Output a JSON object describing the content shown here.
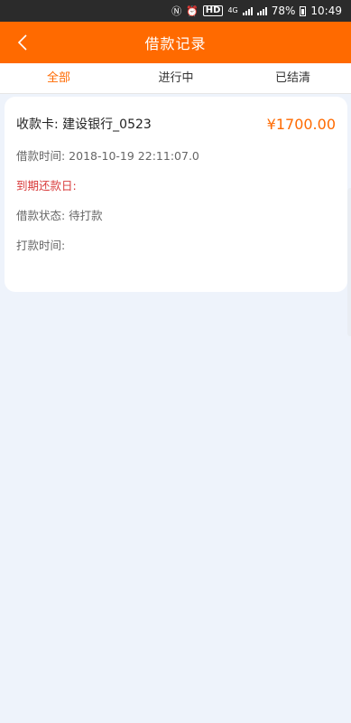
{
  "status_bar": {
    "hd_label": "HD",
    "network_label": "4G",
    "battery_percent": "78%",
    "time": "10:49"
  },
  "header": {
    "title": "借款记录"
  },
  "tabs": [
    {
      "label": "全部",
      "active": true
    },
    {
      "label": "进行中",
      "active": false
    },
    {
      "label": "已结清",
      "active": false
    }
  ],
  "record": {
    "account": "收款卡: 建设银行_0523",
    "amount": "¥1700.00",
    "loan_time": "借款时间: 2018-10-19 22:11:07.0",
    "due_date": "到期还款日:",
    "status": "借款状态: 待打款",
    "payout_time": "打款时间:"
  },
  "colors": {
    "accent": "#ff6a00",
    "due_red": "#d83a3a",
    "page_bg": "#eef3fb"
  }
}
